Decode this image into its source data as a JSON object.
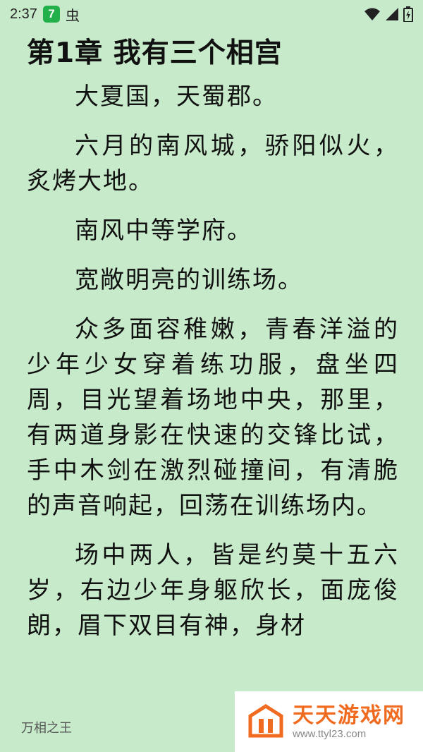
{
  "status_bar": {
    "time": "2:37",
    "app_badge": "7",
    "bug_glyph": "虫"
  },
  "reader": {
    "chapter_title": "第1章 我有三个相宫",
    "paragraphs": [
      "大夏国，天蜀郡。",
      "六月的南风城，骄阳似火，炙烤大地。",
      "南风中等学府。",
      "宽敞明亮的训练场。",
      "众多面容稚嫩，青春洋溢的少年少女穿着练功服，盘坐四周，目光望着场地中央，那里，有两道身影在快速的交锋比试，手中木剑在激烈碰撞间，有清脆的声音响起，回荡在训练场内。",
      "场中两人，皆是约莫十五六岁，右边少年身躯欣长，面庞俊朗，眉下双目有神，身材"
    ]
  },
  "footer": {
    "book_name": "万相之王"
  },
  "watermark": {
    "title": "天天游戏网",
    "url": "www.ttyl23.com",
    "color": "#f06a1f"
  }
}
